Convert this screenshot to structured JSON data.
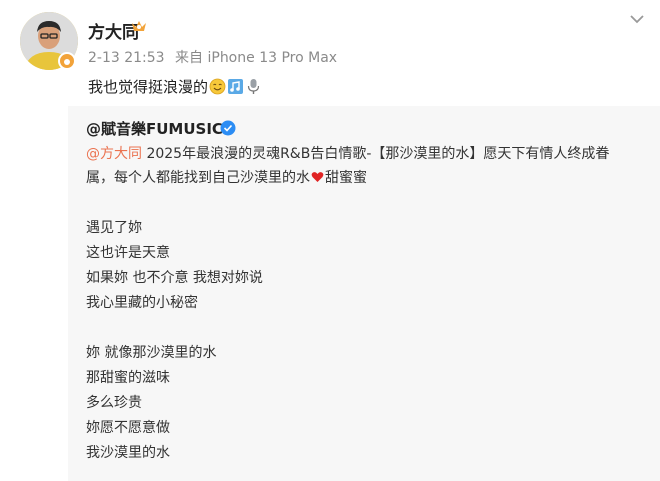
{
  "post": {
    "username": "方大同",
    "date": "2-13 21:53",
    "source": "来自 iPhone 13 Pro Max",
    "text": "我也觉得挺浪漫的"
  },
  "repost": {
    "author": "@賦音樂FUMUSIC",
    "mention": "@方大同",
    "body_line1": " 2025年最浪漫的灵魂R&B告白情歌-【那沙漠里的水】愿天下有情人终成眷",
    "body_line2_a": "属，每个人都能找到自己沙漠里的水",
    "body_line2_b": "甜蜜蜜",
    "stanza1": [
      "遇见了妳",
      "这也许是天意",
      "如果妳  也不介意  我想对妳说",
      "我心里藏的小秘密"
    ],
    "stanza2": [
      "妳  就像那沙漠里的水",
      "那甜蜜的滋味",
      "多么珍贵",
      "妳愿不愿意做",
      "我沙漠里的水"
    ]
  },
  "colors": {
    "mention": "#eb7350",
    "repost_bg": "#f7f7f7",
    "verified": "#2c8df4",
    "heart": "#e02424"
  },
  "icons": [
    "crown-icon",
    "chevron-down-icon",
    "verified-icon",
    "smile-emoji",
    "music-note-emoji",
    "microphone-emoji",
    "heart-icon"
  ]
}
